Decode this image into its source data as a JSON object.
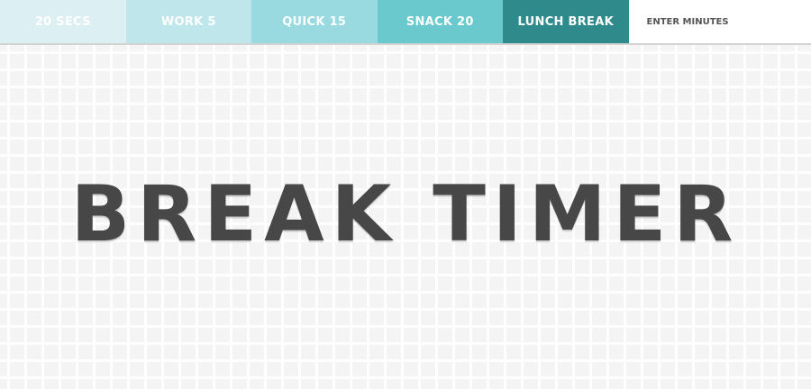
{
  "nav": {
    "buttons": [
      {
        "label": "20 SECS",
        "color": "#dcf0f3"
      },
      {
        "label": "WORK 5",
        "color": "#bfe6ea"
      },
      {
        "label": "QUICK 15",
        "color": "#98dae0"
      },
      {
        "label": "SNACK 20",
        "color": "#69c9cd"
      },
      {
        "label": "LUNCH BREAK",
        "color": "#2f8a8b"
      }
    ],
    "minutes_input": {
      "placeholder": "ENTER MINUTES",
      "value": ""
    }
  },
  "main": {
    "title": "BREAK TIMER"
  },
  "colors": {
    "title_text": "#474747",
    "background": "#f4f4f4",
    "grid": "#ffffff"
  }
}
